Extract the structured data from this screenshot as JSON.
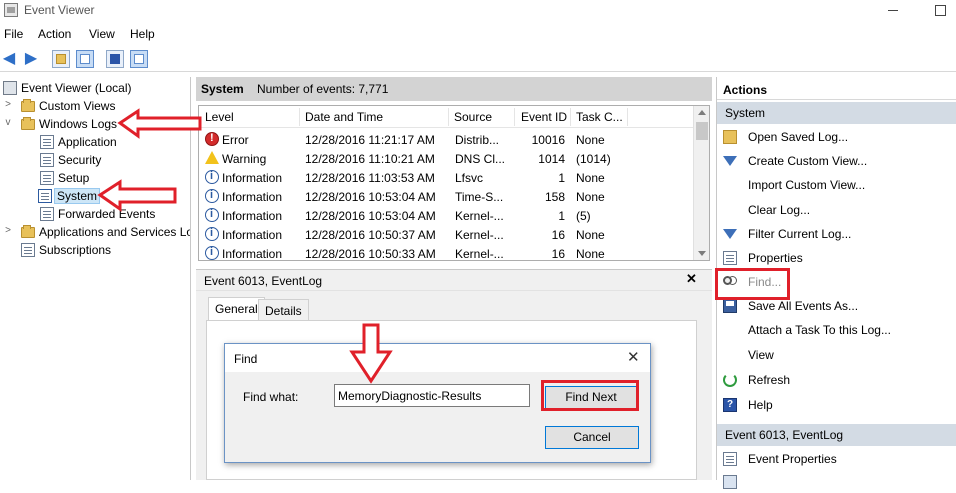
{
  "window": {
    "title": "Event Viewer"
  },
  "menu": [
    "File",
    "Action",
    "View",
    "Help"
  ],
  "tree": {
    "root": "Event Viewer (Local)",
    "custom_views": "Custom Views",
    "windows_logs": "Windows Logs",
    "application": "Application",
    "security": "Security",
    "setup": "Setup",
    "system": "System",
    "forwarded_events": "Forwarded Events",
    "apps_services": "Applications and Services Lo",
    "subscriptions": "Subscriptions"
  },
  "center": {
    "title": "System",
    "count_text": "Number of events: 7,771",
    "columns": [
      "Level",
      "Date and Time",
      "Source",
      "Event ID",
      "Task C..."
    ],
    "rows": [
      {
        "level": "Error",
        "icon": "error-icon",
        "datetime": "12/28/2016 11:21:17 AM",
        "source": "Distrib...",
        "event_id": "10016",
        "task": "None"
      },
      {
        "level": "Warning",
        "icon": "warning-icon",
        "datetime": "12/28/2016 11:10:21 AM",
        "source": "DNS Cl...",
        "event_id": "1014",
        "task": "(1014)"
      },
      {
        "level": "Information",
        "icon": "info-icon",
        "datetime": "12/28/2016 11:03:53 AM",
        "source": "Lfsvc",
        "event_id": "1",
        "task": "None"
      },
      {
        "level": "Information",
        "icon": "info-icon",
        "datetime": "12/28/2016 10:53:04 AM",
        "source": "Time-S...",
        "event_id": "158",
        "task": "None"
      },
      {
        "level": "Information",
        "icon": "info-icon",
        "datetime": "12/28/2016 10:53:04 AM",
        "source": "Kernel-...",
        "event_id": "1",
        "task": "(5)"
      },
      {
        "level": "Information",
        "icon": "info-icon",
        "datetime": "12/28/2016 10:50:37 AM",
        "source": "Kernel-...",
        "event_id": "16",
        "task": "None"
      },
      {
        "level": "Information",
        "icon": "info-icon",
        "datetime": "12/28/2016 10:50:33 AM",
        "source": "Kernel-...",
        "event_id": "16",
        "task": "None"
      }
    ]
  },
  "detail": {
    "title": "Event 6013, EventLog",
    "close": "✕",
    "tabs": [
      "General",
      "Details"
    ]
  },
  "find_dialog": {
    "title": "Find",
    "close": "✕",
    "label": "Find what:",
    "value": "MemoryDiagnostic-Results",
    "find_next": "Find Next",
    "cancel": "Cancel"
  },
  "actions": {
    "header": "Actions",
    "section1": "System",
    "items1": [
      {
        "label": "Open Saved Log...",
        "icon": "open-folder-icon"
      },
      {
        "label": "Create Custom View...",
        "icon": "filter-icon"
      },
      {
        "label": "Import Custom View...",
        "icon": ""
      },
      {
        "label": "Clear Log...",
        "icon": ""
      },
      {
        "label": "Filter Current Log...",
        "icon": "filter-icon"
      },
      {
        "label": "Properties",
        "icon": "properties-icon"
      },
      {
        "label": "Find...",
        "icon": "binoculars-icon",
        "disabled": true
      },
      {
        "label": "Save All Events As...",
        "icon": "save-icon"
      },
      {
        "label": "Attach a Task To this Log...",
        "icon": ""
      },
      {
        "label": "View",
        "icon": ""
      },
      {
        "label": "Refresh",
        "icon": "refresh-icon"
      },
      {
        "label": "Help",
        "icon": "help-icon"
      }
    ],
    "section2": "Event 6013, EventLog",
    "items2": [
      {
        "label": "Event Properties",
        "icon": "event-properties-icon"
      }
    ]
  },
  "colors": {
    "annotation": "#e0202a",
    "header_gray": "#d3d3d3",
    "section_blue": "#d3dbe4",
    "selection": "#cde6f7"
  }
}
